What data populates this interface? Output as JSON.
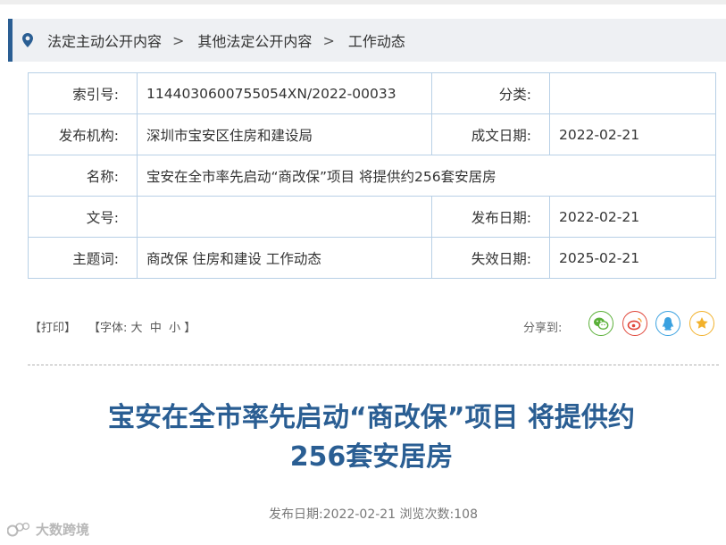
{
  "breadcrumb": [
    "法定主动公开内容",
    "其他法定公开内容",
    "工作动态"
  ],
  "breadcrumb_separator": ">",
  "meta": {
    "index_label": "索引号:",
    "index_value": "1144030600755054XN/2022-00033",
    "category_label": "分类:",
    "category_value": "",
    "publisher_label": "发布机构:",
    "publisher_value": "深圳市宝安区住房和建设局",
    "created_label": "成文日期:",
    "created_value": "2022-02-21",
    "name_label": "名称:",
    "name_value": "宝安在全市率先启动“商改保”项目 将提供约256套安居房",
    "docno_label": "文号:",
    "docno_value": "",
    "pubdate_label": "发布日期:",
    "pubdate_value": "2022-02-21",
    "keywords_label": "主题词:",
    "keywords_value": "商改保 住房和建设 工作动态",
    "expire_label": "失效日期:",
    "expire_value": "2025-02-21"
  },
  "toolbar": {
    "print": "【打印】",
    "font_prefix": "【字体:",
    "font_large": "大",
    "font_medium": "中",
    "font_small": "小",
    "font_suffix": "】",
    "share_label": "分享到:"
  },
  "share_icons": [
    "wechat-icon",
    "weibo-icon",
    "qq-icon",
    "qzone-icon"
  ],
  "colors": {
    "accent": "#2a5e93",
    "table_border": "#b8d0e6",
    "wechat": "#5ab038",
    "weibo": "#e0463a",
    "qq": "#3aa1e0",
    "qzone": "#f2b12b"
  },
  "article": {
    "title_line1": "宝安在全市率先启动“商改保”项目 将提供约",
    "title_line2": "256套安居房",
    "pubinfo": "发布日期:2022-02-21 浏览次数:108"
  },
  "watermark": "大数跨境"
}
